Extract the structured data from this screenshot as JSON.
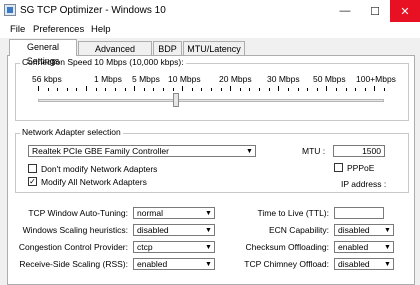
{
  "window": {
    "title": "SG TCP Optimizer - Windows 10",
    "minimize": "—",
    "maximize": "☐",
    "close": "✕"
  },
  "menu": [
    "File",
    "Preferences",
    "Help"
  ],
  "tabs": [
    "General Settings",
    "Advanced Settings",
    "BDP",
    "MTU/Latency"
  ],
  "active_tab": "General Settings",
  "connection": {
    "label": "Connection Speed  10 Mbps (10,000 kbps):",
    "ticks": [
      "56 kbps",
      "1 Mbps",
      "5 Mbps",
      "10 Mbps",
      "20 Mbps",
      "30 Mbps",
      "50 Mbps",
      "100+Mbps"
    ],
    "selected": "10 Mbps"
  },
  "adapter": {
    "label": "Network Adapter selection",
    "selected": "Realtek PCIe GBE Family Controller",
    "dont_modify": "Don't modify Network Adapters",
    "dont_modify_checked": false,
    "modify_all": "Modify All Network Adapters",
    "modify_all_checked": true,
    "mtu_label": "MTU :",
    "mtu_value": "1500",
    "pppoe": "PPPoE",
    "pppoe_checked": false,
    "ip_label": "IP address :"
  },
  "settings_left": [
    {
      "label": "TCP Window Auto-Tuning:",
      "value": "normal"
    },
    {
      "label": "Windows Scaling heuristics:",
      "value": "disabled"
    },
    {
      "label": "Congestion Control Provider:",
      "value": "ctcp"
    },
    {
      "label": "Receive-Side Scaling (RSS):",
      "value": "enabled"
    }
  ],
  "settings_right": [
    {
      "label": "Time to Live (TTL):",
      "value": ""
    },
    {
      "label": "ECN Capability:",
      "value": "disabled"
    },
    {
      "label": "Checksum Offloading:",
      "value": "enabled"
    },
    {
      "label": "TCP Chimney Offload:",
      "value": "disabled"
    }
  ]
}
